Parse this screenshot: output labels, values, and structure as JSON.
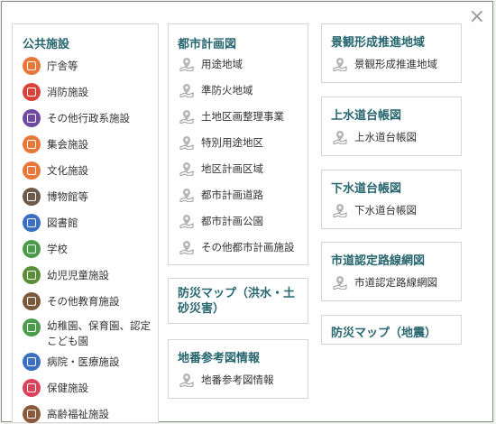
{
  "close_icon": "×",
  "public_facilities": {
    "header": "公共施設",
    "items": [
      {
        "label": "庁舎等",
        "color": "#e8773a",
        "icon": "building-icon"
      },
      {
        "label": "消防施設",
        "color": "#d9443a",
        "icon": "fire-icon"
      },
      {
        "label": "その他行政系施設",
        "color": "#6f4aa0",
        "icon": "admin-icon"
      },
      {
        "label": "集会施設",
        "color": "#e8773a",
        "icon": "group-icon"
      },
      {
        "label": "文化施設",
        "color": "#e8773a",
        "icon": "culture-icon"
      },
      {
        "label": "博物館等",
        "color": "#6d5a4a",
        "icon": "museum-icon"
      },
      {
        "label": "図書館",
        "color": "#3a6fc1",
        "icon": "book-icon"
      },
      {
        "label": "学校",
        "color": "#4b9c4b",
        "icon": "school-icon"
      },
      {
        "label": "幼児児童施設",
        "color": "#5a8f3a",
        "icon": "child-icon"
      },
      {
        "label": "その他教育施設",
        "color": "#7a5a3a",
        "icon": "education-icon"
      },
      {
        "label": "幼稚園、保育園、認定こども園",
        "color": "#4b9c4b",
        "icon": "kindergarten-icon"
      },
      {
        "label": "病院・医療施設",
        "color": "#3a6fc1",
        "icon": "hospital-icon"
      },
      {
        "label": "保健施設",
        "color": "#d9445a",
        "icon": "health-icon"
      },
      {
        "label": "高齢福祉施設",
        "color": "#8a5a3a",
        "icon": "elderly-icon"
      }
    ]
  },
  "urban_planning": {
    "header": "都市計画図",
    "items": [
      "用途地域",
      "準防火地域",
      "土地区画整理事業",
      "特別用途地区",
      "地区計画区域",
      "都市計画道路",
      "都市計画公園",
      "その他都市計画施設"
    ]
  },
  "disaster_flood": {
    "header": "防災マップ（洪水・土砂災害）"
  },
  "cadastral": {
    "header": "地番参考図情報",
    "items": [
      "地番参考図情報"
    ]
  },
  "landscape": {
    "header": "景観形成推進地域",
    "items": [
      "景観形成推進地域"
    ]
  },
  "water_supply": {
    "header": "上水道台帳図",
    "items": [
      "上水道台帳図"
    ]
  },
  "sewer": {
    "header": "下水道台帳図",
    "items": [
      "下水道台帳図"
    ]
  },
  "roads": {
    "header": "市道認定路線網図",
    "items": [
      "市道認定路線網図"
    ]
  },
  "disaster_quake": {
    "header": "防災マップ（地震）"
  },
  "colors": {
    "heading": "#27666e",
    "pin": "#8a8a8a"
  }
}
